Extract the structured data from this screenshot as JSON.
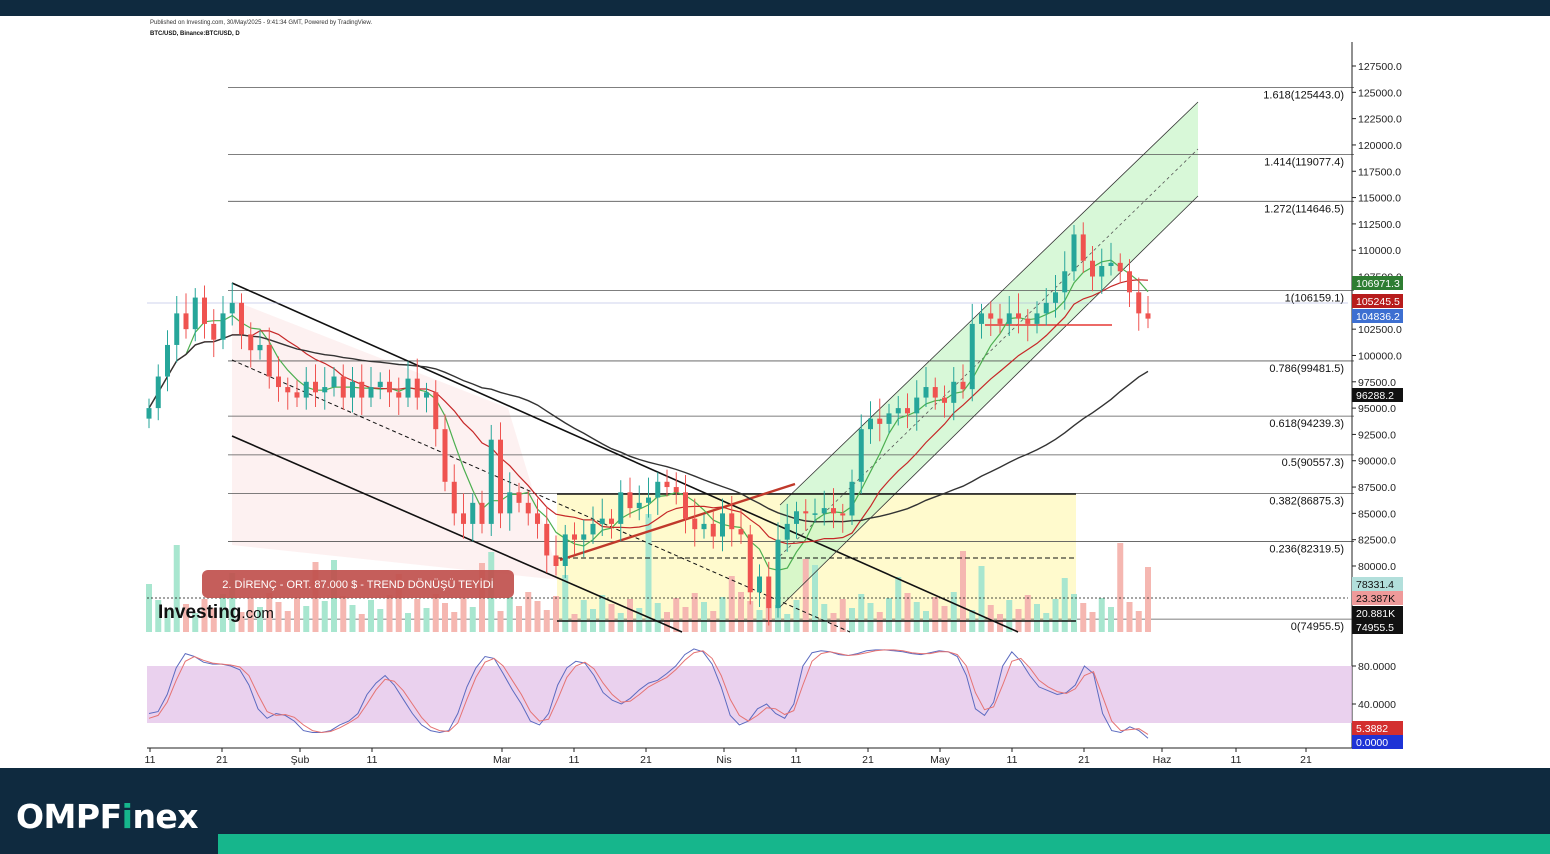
{
  "header": {
    "published": "Published on Investing.com, 30/May/2025 - 9:41:34 GMT, Powered by TradingView.",
    "symbol": "BTC/USD, Binance:BTC/USD, D"
  },
  "watermark": "Investing",
  "watermark_suffix": ".com",
  "annotation": "2. DİRENÇ - ORT. 87.000 $ - TREND DÖNÜŞÜ TEYİDİ",
  "brand": {
    "prefix": "OMPF",
    "accent": "i",
    "suffix": "nex"
  },
  "colors": {
    "accent": "#16b68c",
    "navy": "#0f2a3f",
    "up": "#26a69a",
    "down": "#ef5350"
  },
  "chart_data": {
    "type": "candlestick",
    "price_axis": {
      "ticks": [
        127500,
        125000,
        122500,
        120000,
        117500,
        115000,
        112500,
        110000,
        107500,
        105000,
        102500,
        100000,
        97500,
        95000,
        92500,
        90000,
        87500,
        85000,
        82500,
        80000
      ],
      "labels": [
        "127500.0",
        "125000.0",
        "122500.0",
        "120000.0",
        "117500.0",
        "115000.0",
        "112500.0",
        "110000.0",
        "107500.0",
        "105000.0",
        "102500.0",
        "100000.0",
        "97500.0",
        "95000.0",
        "92500.0",
        "90000.0",
        "87500.0",
        "85000.0",
        "82500.0",
        "80000.0"
      ]
    },
    "time_axis": [
      "11",
      "21",
      "Şub",
      "11",
      "Mar",
      "11",
      "21",
      "Nis",
      "11",
      "21",
      "May",
      "11",
      "21",
      "Haz",
      "11",
      "21"
    ],
    "fibonacci": [
      {
        "label": "1.618(125443.0)",
        "value": 125443.0
      },
      {
        "label": "1.414(119077.4)",
        "value": 119077.4
      },
      {
        "label": "1.272(114646.5)",
        "value": 114646.5
      },
      {
        "label": "1(106159.1)",
        "value": 106159.1
      },
      {
        "label": "0.786(99481.5)",
        "value": 99481.5
      },
      {
        "label": "0.618(94239.3)",
        "value": 94239.3
      },
      {
        "label": "0.5(90557.3)",
        "value": 90557.3
      },
      {
        "label": "0.382(86875.3)",
        "value": 86875.3
      },
      {
        "label": "0.236(82319.5)",
        "value": 82319.5
      },
      {
        "label": "0(74955.5)",
        "value": 74955.5
      }
    ],
    "price_tags": [
      {
        "text": "106971.3",
        "color": "#2e7d32"
      },
      {
        "text": "105245.5",
        "color": "#b71c1c"
      },
      {
        "text": "104836.2",
        "color": "#3d6fd1"
      },
      {
        "text": "96288.2",
        "color": "#111111"
      },
      {
        "text": "78331.4",
        "color": "#b2dfdb"
      },
      {
        "text": "23.387K",
        "color": "#ef9a9a"
      },
      {
        "text": "20.881K",
        "color": "#111111"
      },
      {
        "text": "74955.5",
        "color": "#111111"
      }
    ],
    "oscillator": {
      "ticks": [
        80,
        40
      ],
      "tick_labels": [
        "80.0000",
        "40.0000"
      ],
      "band": [
        20,
        80
      ],
      "tags": [
        {
          "text": "5.3882",
          "color": "#d32f2f"
        },
        {
          "text": "0.0000",
          "color": "#1e33d6"
        }
      ],
      "k": [
        30,
        32,
        50,
        78,
        93,
        90,
        84,
        82,
        82,
        80,
        76,
        60,
        35,
        25,
        30,
        28,
        22,
        12,
        10,
        10,
        12,
        18,
        22,
        30,
        50,
        62,
        70,
        60,
        45,
        30,
        18,
        12,
        10,
        12,
        30,
        58,
        78,
        90,
        88,
        72,
        55,
        40,
        22,
        18,
        30,
        60,
        78,
        85,
        83,
        70,
        52,
        44,
        40,
        46,
        55,
        62,
        65,
        72,
        80,
        92,
        98,
        95,
        82,
        58,
        28,
        18,
        22,
        35,
        40,
        30,
        25,
        40,
        80,
        94,
        96,
        95,
        92,
        91,
        93,
        96,
        97,
        97,
        96,
        95,
        93,
        92,
        94,
        96,
        95,
        90,
        70,
        35,
        28,
        42,
        80,
        95,
        85,
        70,
        58,
        54,
        50,
        52,
        60,
        80,
        72,
        30,
        12,
        10,
        16,
        12,
        4
      ],
      "d": [
        25,
        28,
        42,
        65,
        85,
        90,
        86,
        83,
        82,
        81,
        79,
        70,
        50,
        32,
        28,
        29,
        26,
        18,
        12,
        10,
        11,
        15,
        20,
        26,
        40,
        55,
        66,
        64,
        54,
        40,
        26,
        16,
        12,
        11,
        20,
        45,
        68,
        84,
        88,
        80,
        65,
        50,
        32,
        22,
        24,
        45,
        68,
        80,
        84,
        77,
        62,
        50,
        42,
        43,
        50,
        58,
        63,
        68,
        76,
        86,
        94,
        96,
        88,
        70,
        45,
        28,
        22,
        28,
        36,
        35,
        29,
        33,
        60,
        85,
        93,
        95,
        93,
        91,
        92,
        94,
        96,
        97,
        97,
        96,
        94,
        93,
        93,
        95,
        95,
        92,
        80,
        52,
        34,
        37,
        60,
        85,
        88,
        78,
        65,
        58,
        53,
        51,
        56,
        70,
        74,
        48,
        22,
        12,
        13,
        14,
        8
      ]
    },
    "series": [
      {
        "name": "close",
        "values": [
          95000,
          98000,
          101000,
          104000,
          102500,
          105500,
          103000,
          101500,
          104000,
          105000,
          102000,
          100500,
          101000,
          98000,
          97000,
          96500,
          96000,
          97500,
          96500,
          97000,
          98000,
          96000,
          97500,
          96000,
          97000,
          97500,
          96500,
          96000,
          97800,
          96000,
          96500,
          93000,
          88000,
          85000,
          84000,
          86000,
          84000,
          92000,
          85000,
          87000,
          86000,
          85000,
          84000,
          81000,
          80000,
          83000,
          82500,
          83000,
          84000,
          84500,
          84000,
          87000,
          85500,
          86000,
          86500,
          88000,
          87500,
          87000,
          84500,
          83500,
          84000,
          82800,
          85000,
          83500,
          83000,
          77500,
          79000,
          76000,
          82500,
          84000,
          85200,
          85000,
          85000,
          85500,
          85000,
          84800,
          88000,
          93000,
          94000,
          93500,
          94500,
          95000,
          94500,
          96000,
          97000,
          96000,
          95500,
          97500,
          96800,
          103000,
          104000,
          103500,
          103000,
          104000,
          103500,
          103000,
          104000,
          105000,
          106000,
          108000,
          111500,
          109000,
          107500,
          108500,
          108800,
          108000,
          106000,
          104000,
          103500
        ]
      }
    ]
  }
}
